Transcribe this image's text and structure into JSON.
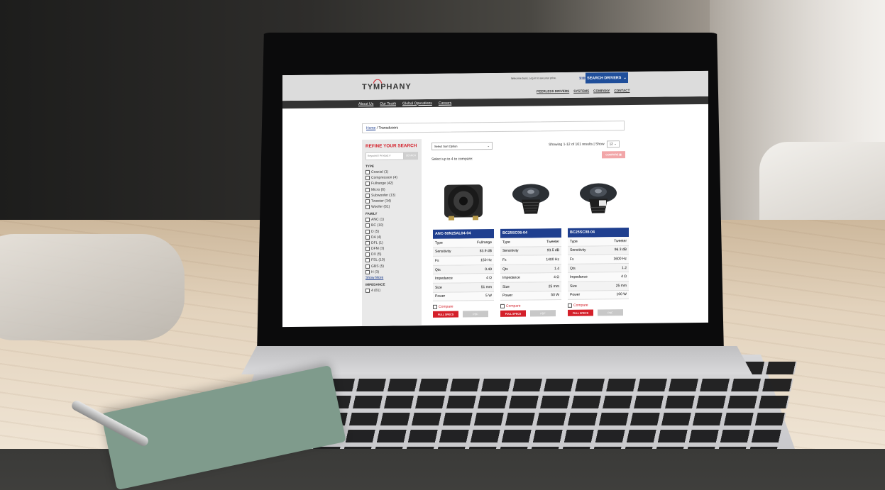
{
  "site": {
    "logo": "TYMPHANY",
    "welcome": "Welcome back, Log in to see your price.",
    "language": "繁體中文",
    "search_drivers": "SEARCH DRIVERS",
    "topnav": [
      "PEERLESS DRIVERS",
      "SYSTEMS",
      "COMPANY",
      "CONTACT"
    ],
    "subnav": [
      "About Us",
      "Our Team",
      "Global Operations",
      "Careers"
    ]
  },
  "breadcrumb": {
    "home": "Home",
    "sep": "/",
    "current": "Transducers"
  },
  "filters": {
    "title": "REFINE YOUR SEARCH",
    "keyword_placeholder": "Keyword / Product #",
    "keyword_button": "SEARCH",
    "groups": [
      {
        "name": "TYPE",
        "options": [
          "Coaxial (1)",
          "Compression (4)",
          "Fullrange (42)",
          "Micro (6)",
          "Subwoofer (13)",
          "Tweeter (34)",
          "Woofer (61)"
        ]
      },
      {
        "name": "FAMILY",
        "options": [
          "ANC (1)",
          "BC (10)",
          "D (5)",
          "DA (4)",
          "DFL (1)",
          "DFM (3)",
          "DX (5)",
          "FSL (10)",
          "GBS (5)",
          "H (3)"
        ]
      }
    ],
    "show_more": "Show More",
    "impedance_title": "IMPEDANCE",
    "impedance_options": [
      "4 (81)"
    ]
  },
  "results": {
    "sort_placeholder": "Select Sort Option",
    "showing": "Showing 1-12 of 161 results | Show",
    "per_page": "12",
    "compare_button": "COMPARE",
    "select_note": "Select up to 4 to compare:",
    "compare_label": "Compare",
    "full_specs": "FULL SPECS",
    "pdf": "PDF",
    "products": [
      {
        "name": "ANC-50N25AL04-04",
        "image": "woofer",
        "specs": [
          [
            "Type",
            "Fullrange"
          ],
          [
            "Sensitivity",
            "83.9 dB"
          ],
          [
            "Fs",
            "150 Hz"
          ],
          [
            "Qts",
            "0.49"
          ],
          [
            "Impedance",
            "4 Ω"
          ],
          [
            "Size",
            "51 mm"
          ],
          [
            "Power",
            "5 W"
          ]
        ]
      },
      {
        "name": "BC25SC06-04",
        "image": "tweeter",
        "specs": [
          [
            "Type",
            "Tweeter"
          ],
          [
            "Sensitivity",
            "93.5 dB"
          ],
          [
            "Fs",
            "1400 Hz"
          ],
          [
            "Qts",
            "1.4"
          ],
          [
            "Impedance",
            "4 Ω"
          ],
          [
            "Size",
            "25 mm"
          ],
          [
            "Power",
            "50 W"
          ]
        ]
      },
      {
        "name": "BC25SC08-04",
        "image": "tweeter",
        "specs": [
          [
            "Type",
            "Tweeter"
          ],
          [
            "Sensitivity",
            "96.3 dB"
          ],
          [
            "Fs",
            "1600 Hz"
          ],
          [
            "Qts",
            "1.2"
          ],
          [
            "Impedance",
            "4 Ω"
          ],
          [
            "Size",
            "25 mm"
          ],
          [
            "Power",
            "100 W"
          ]
        ]
      }
    ]
  }
}
